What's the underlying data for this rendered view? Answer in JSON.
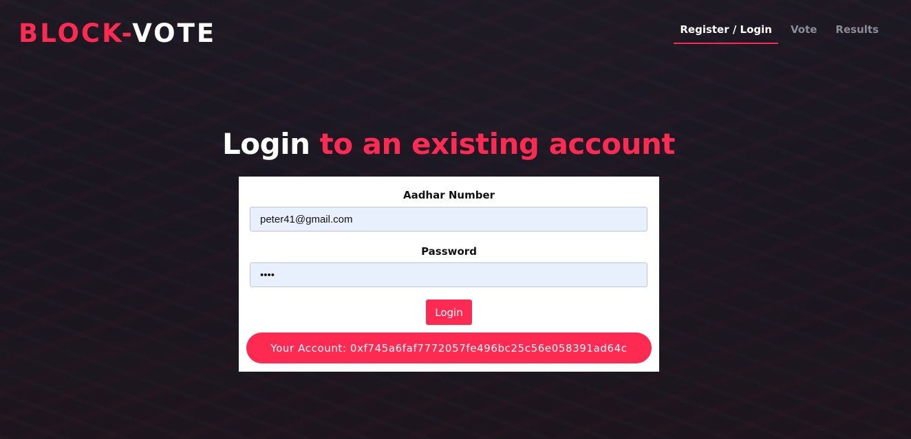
{
  "header": {
    "logo_accent": "BLOCK-",
    "logo_main": "VOTE",
    "nav": [
      {
        "label": "Register / Login",
        "active": true
      },
      {
        "label": "Vote",
        "active": false
      },
      {
        "label": "Results",
        "active": false
      }
    ]
  },
  "main": {
    "title_white": "Login",
    "title_accent": "to an existing account",
    "form": {
      "aadhar_label": "Aadhar Number",
      "aadhar_value": "peter41@gmail.com",
      "password_label": "Password",
      "password_value": "1234",
      "login_label": "Login",
      "account_text": "Your Account: 0xf745a6faf7772057fe496bc25c56e058391ad64c"
    }
  },
  "colors": {
    "accent": "#ff2a52",
    "input_bg": "#e8f0fe",
    "nav_inactive": "#8c8c98"
  }
}
